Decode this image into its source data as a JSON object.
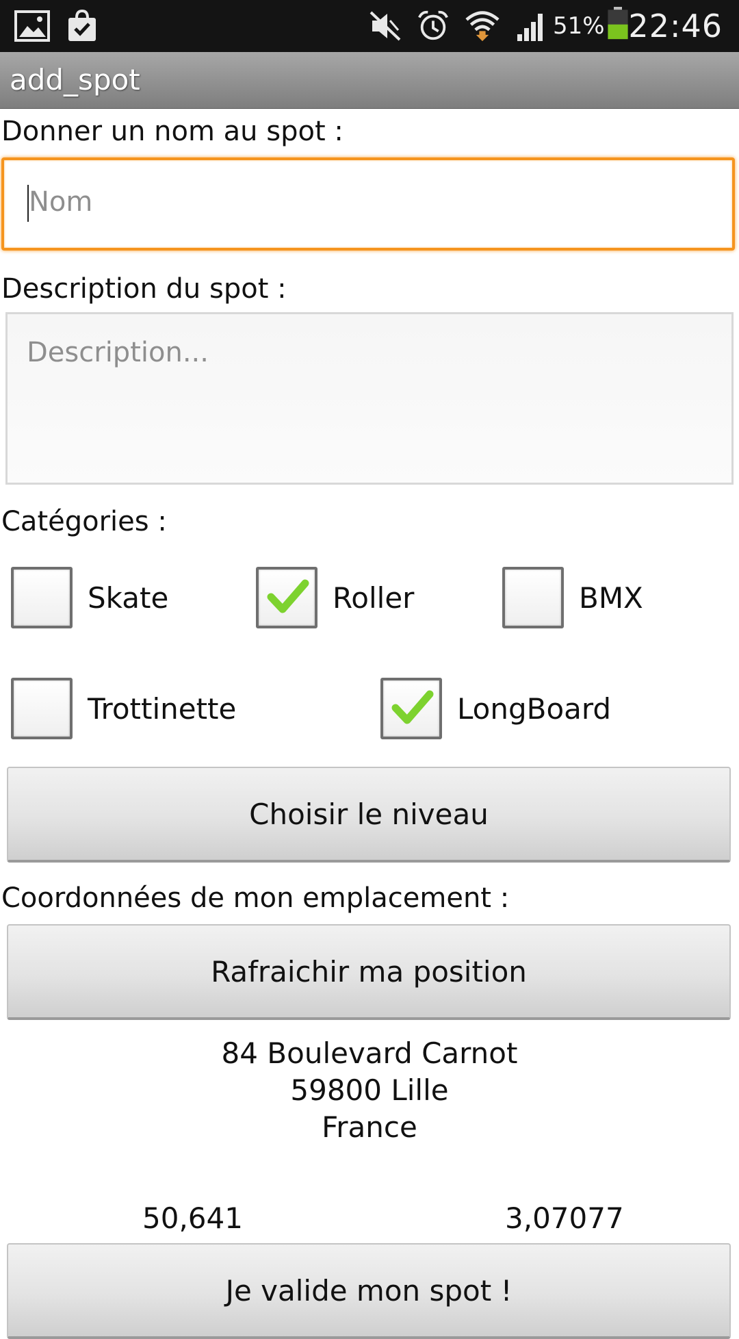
{
  "status_bar": {
    "battery_percent": "51%",
    "time": "22:46",
    "icons": [
      "image-icon",
      "shopping-bag-icon",
      "mute-icon",
      "alarm-icon",
      "wifi-icon",
      "signal-icon",
      "battery-icon"
    ]
  },
  "app_bar": {
    "title": "add_spot"
  },
  "form": {
    "name_label": "Donner un nom au spot :",
    "name_placeholder": "Nom",
    "description_label": "Description du spot :",
    "description_placeholder": "Description...",
    "categories_label": "Catégories :",
    "categories": [
      {
        "label": "Skate",
        "checked": false
      },
      {
        "label": "Roller",
        "checked": true
      },
      {
        "label": "BMX",
        "checked": false
      },
      {
        "label": "Trottinette",
        "checked": false
      },
      {
        "label": "LongBoard",
        "checked": true
      }
    ],
    "level_button": "Choisir le niveau",
    "location_label": "Coordonnées de mon emplacement :",
    "refresh_button": "Rafraichir ma position",
    "address": {
      "street": "84 Boulevard Carnot",
      "city": "59800 Lille",
      "country": "France"
    },
    "latitude": "50,641",
    "longitude": "3,07077",
    "submit_button": "Je valide mon spot !"
  },
  "colors": {
    "focus_accent": "#f5941e",
    "check_green": "#7dd22f",
    "status_bar_bg": "#141414",
    "title_bar_bg": "#8f8f8f"
  }
}
